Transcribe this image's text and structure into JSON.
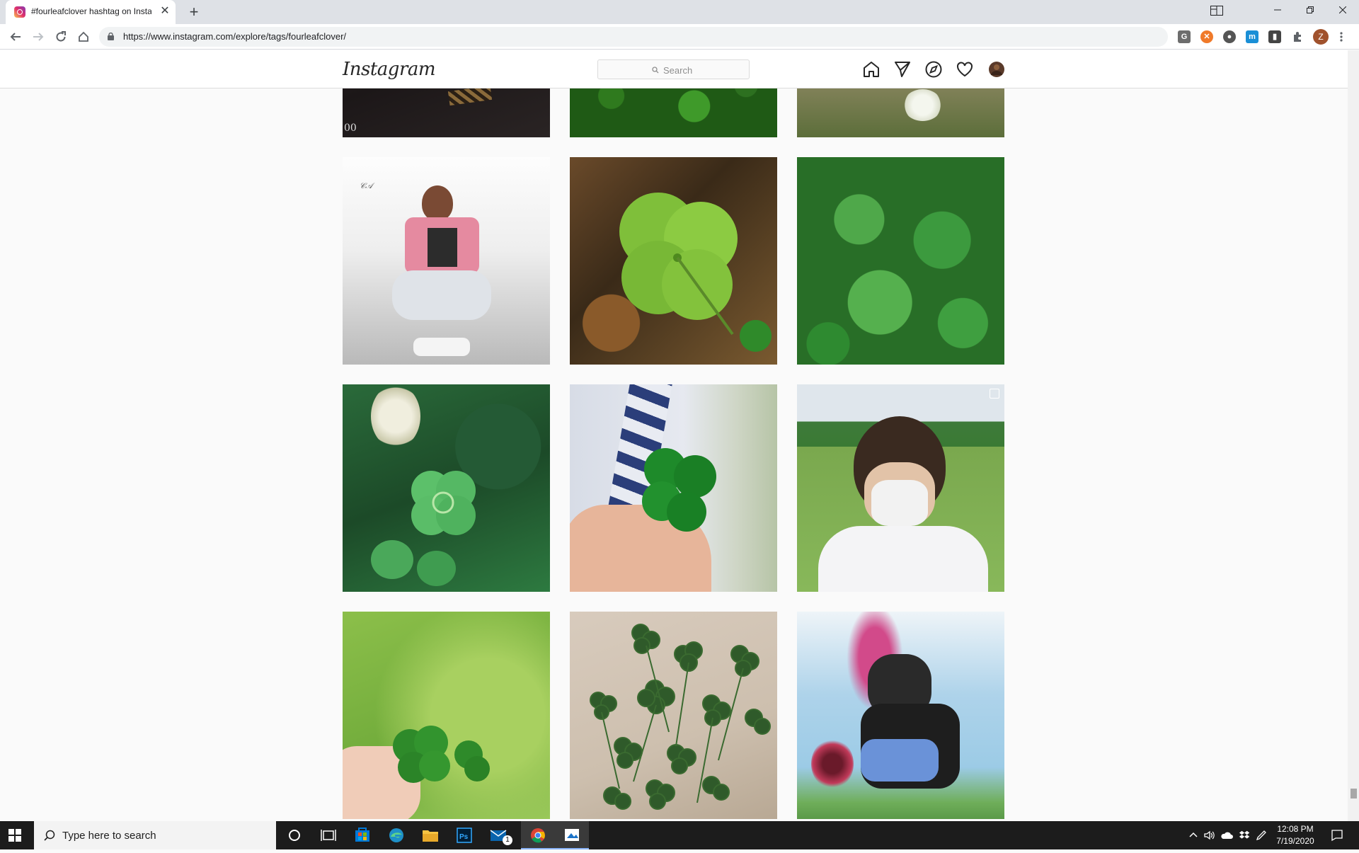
{
  "browser": {
    "tab_title": "#fourleafclover hashtag on Instagram",
    "tab_close_label": "✕",
    "new_tab_label": "+",
    "url": "https://www.instagram.com/explore/tags/fourleafclover/",
    "profile_initial": "Z",
    "extensions": [
      {
        "name": "grammar-extension-icon",
        "label": "G",
        "color": "#6d6d6d"
      },
      {
        "name": "orange-extension-icon",
        "label": "✕",
        "color": "#f07a2a"
      },
      {
        "name": "circle-extension-icon",
        "label": "●",
        "color": "#555555"
      },
      {
        "name": "m-extension-icon",
        "label": "m",
        "color": "#1a8fd6"
      },
      {
        "name": "book-extension-icon",
        "label": "▮",
        "color": "#444444"
      }
    ]
  },
  "instagram": {
    "logo_text": "Instagram",
    "search_placeholder": "Search"
  },
  "grid": {
    "tiles": [
      {
        "name": "post-1",
        "desc": "dark photo with leopard print"
      },
      {
        "name": "post-2",
        "desc": "clover patch"
      },
      {
        "name": "post-3",
        "desc": "clover with white flower"
      },
      {
        "name": "post-4",
        "desc": "young man sitting pink shirt"
      },
      {
        "name": "post-5",
        "desc": "four leaf clover on ground"
      },
      {
        "name": "post-6",
        "desc": "clover bushes"
      },
      {
        "name": "post-7",
        "desc": "four leaf clover in grass"
      },
      {
        "name": "post-8",
        "desc": "hand holding four leaf clover"
      },
      {
        "name": "post-9",
        "desc": "person wearing mask in park"
      },
      {
        "name": "post-10",
        "desc": "fingers holding clovers"
      },
      {
        "name": "post-11",
        "desc": "pressed clovers"
      },
      {
        "name": "post-12",
        "desc": "anime drawing"
      }
    ],
    "tile_1_overlay_text": "00"
  },
  "taskbar": {
    "search_placeholder": "Type here to search",
    "time": "12:08 PM",
    "date": "7/19/2020",
    "mail_badge": "1"
  }
}
